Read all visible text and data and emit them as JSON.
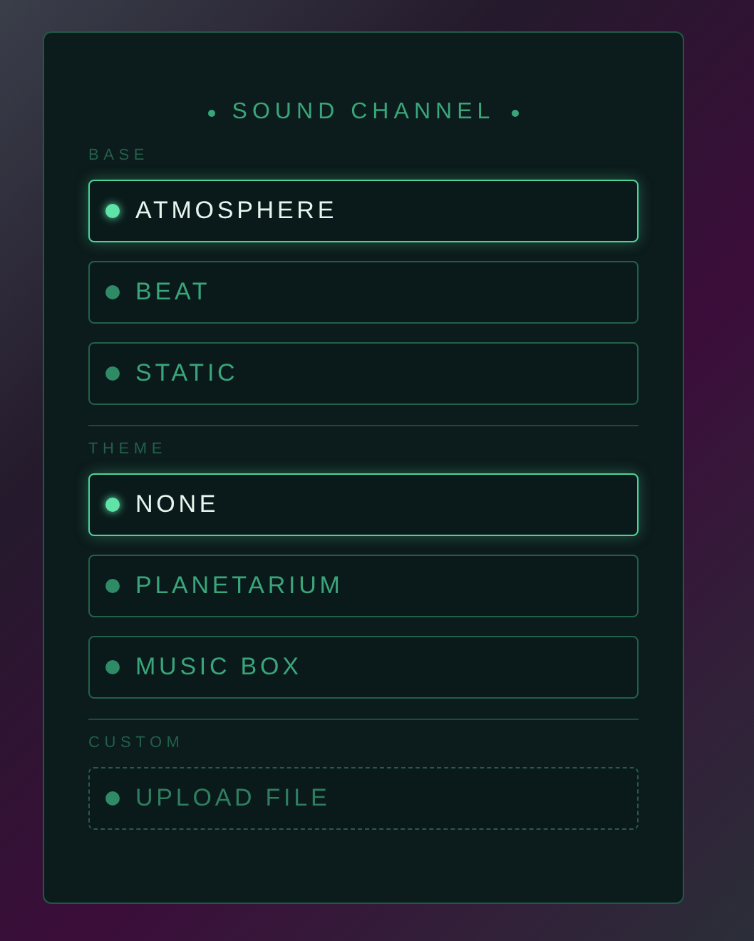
{
  "panel": {
    "title": "SOUND CHANNEL",
    "sections": [
      {
        "label": "BASE",
        "options": [
          {
            "label": "ATMOSPHERE",
            "kind": "option",
            "selected": true
          },
          {
            "label": "BEAT",
            "kind": "option",
            "selected": false
          },
          {
            "label": "STATIC",
            "kind": "option",
            "selected": false
          }
        ]
      },
      {
        "label": "THEME",
        "options": [
          {
            "label": "NONE",
            "kind": "option",
            "selected": true
          },
          {
            "label": "PLANETARIUM",
            "kind": "option",
            "selected": false
          },
          {
            "label": "MUSIC BOX",
            "kind": "option",
            "selected": false
          }
        ]
      },
      {
        "label": "CUSTOM",
        "options": [
          {
            "label": "UPLOAD FILE",
            "kind": "upload",
            "selected": false
          }
        ]
      }
    ]
  }
}
